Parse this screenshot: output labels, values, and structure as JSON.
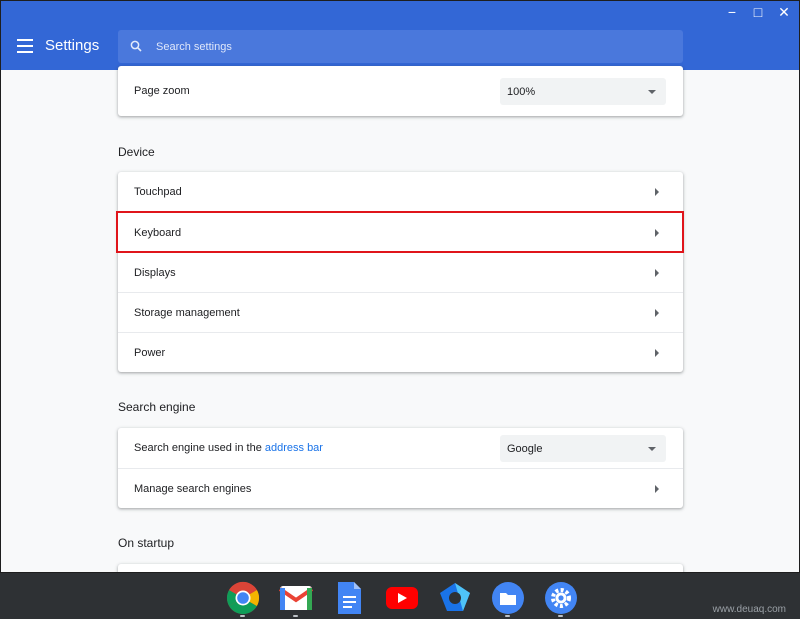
{
  "window": {
    "controls": {
      "minimize": "−",
      "maximize": "□",
      "close": "✕"
    }
  },
  "header": {
    "title": "Settings",
    "menu_icon": "hamburger-menu-icon",
    "search": {
      "placeholder": "Search settings",
      "value": ""
    }
  },
  "page_zoom": {
    "label": "Page zoom",
    "value": "100%"
  },
  "device": {
    "section_title": "Device",
    "items": [
      {
        "label": "Touchpad"
      },
      {
        "label": "Keyboard",
        "highlighted": true
      },
      {
        "label": "Displays"
      },
      {
        "label": "Storage management"
      },
      {
        "label": "Power"
      }
    ]
  },
  "search_engine": {
    "section_title": "Search engine",
    "used_label_prefix": "Search engine used in the ",
    "used_label_link": "address bar",
    "selected": "Google",
    "manage_label": "Manage search engines"
  },
  "on_startup": {
    "section_title": "On startup"
  },
  "shelf": {
    "apps": [
      "chrome-icon",
      "gmail-icon",
      "docs-icon",
      "youtube-icon",
      "cloud-app-icon",
      "files-icon",
      "settings-icon"
    ]
  },
  "watermark": "www.deuaq.com",
  "colors": {
    "accent": "#3367d6",
    "link": "#1a73e8",
    "highlight": "#e0151b"
  }
}
